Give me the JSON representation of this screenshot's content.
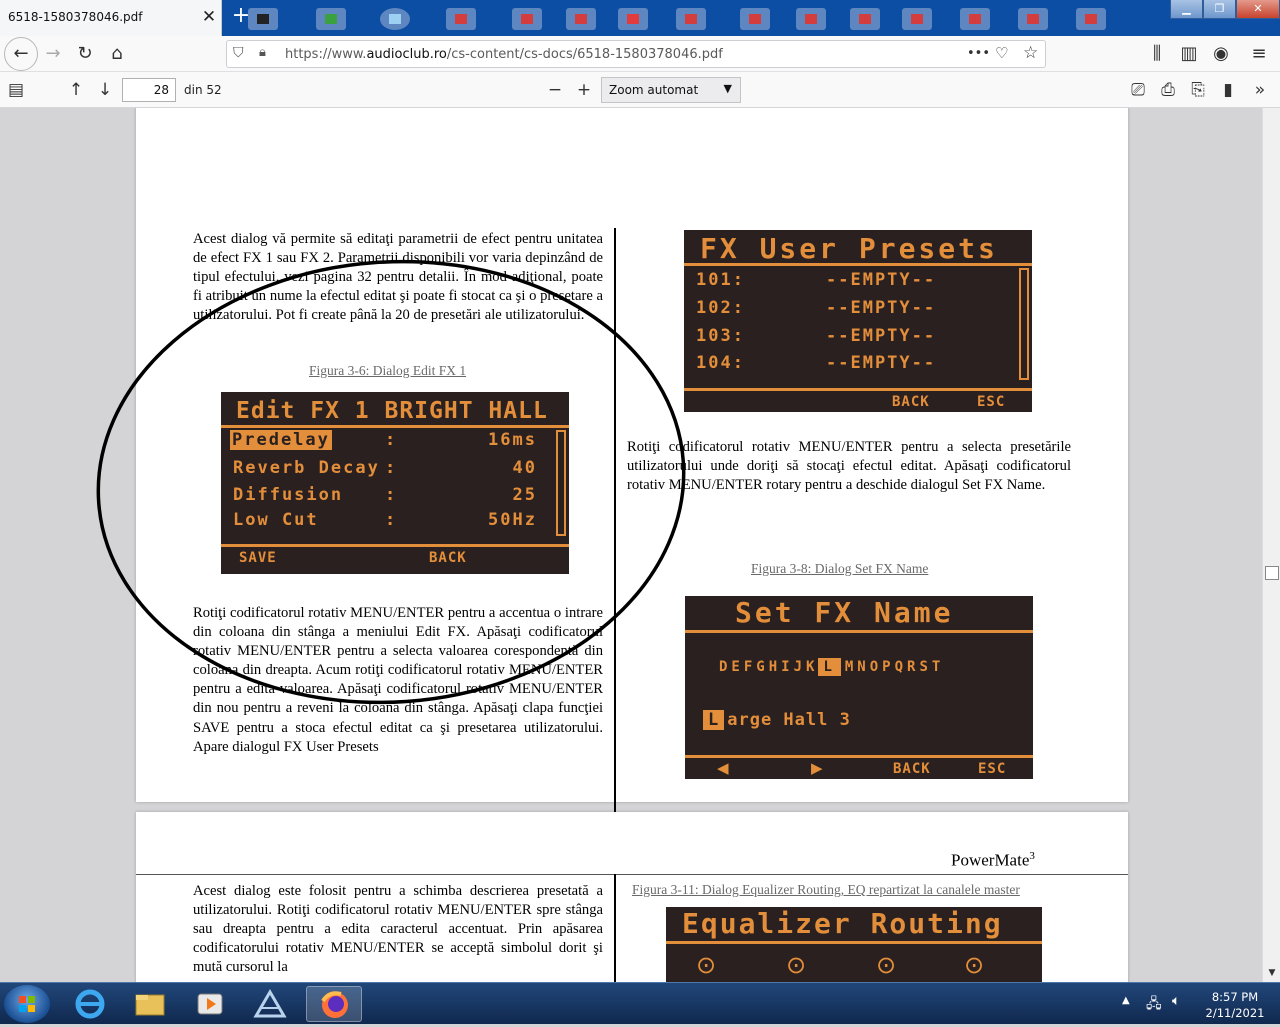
{
  "browser": {
    "tab_title": "6518-1580378046.pdf",
    "tab_close": "✕",
    "new_tab": "+",
    "url_prefix": "https://www.",
    "url_domain": "audioclub.ro",
    "url_path": "/cs-content/cs-docs/6518-1580378046.pdf",
    "url_more": "•••"
  },
  "pdf_toolbar": {
    "page_number": "28",
    "page_total": "din 52",
    "zoom_label": "Zoom automat"
  },
  "page1": {
    "left_paragraph_1": "Acest dialog vă permite să editaţi parametrii de efect pentru unitatea de efect FX 1 sau FX 2. Parametrii disponibili vor varia depinzând de tipul efectului, vezi pagina 32 pentru detalii. În mod adiţional, poate fi atribuit un nume la efectul editat şi poate fi stocat ca şi o presetare a utilizatorului. Pot fi create până la 20 de presetări ale utilizatorului.",
    "caption_fig36": "Figura 3-6: Dialog Edit  FX 1",
    "edit_fx": {
      "title": "Edit FX 1 BRIGHT HALL",
      "rows": [
        {
          "name": "Predelay",
          "sep": ":",
          "value": "16ms"
        },
        {
          "name": "Reverb Decay",
          "sep": ":",
          "value": "40"
        },
        {
          "name": "Diffusion",
          "sep": ":",
          "value": "25"
        },
        {
          "name": "Low Cut",
          "sep": ":",
          "value": "50Hz"
        }
      ],
      "soft_left": "SAVE",
      "soft_right": "BACK"
    },
    "left_paragraph_2": "Rotiţi codificatorul rotativ MENU/ENTER pentru a accentua o intrare din coloana din stânga a meniului Edit FX. Apăsaţi codificatorul rotativ MENU/ENTER pentru a selecta valoarea corespondentă din coloana din dreapta. Acum rotiţi codificatorul rotativ MENU/ENTER pentru a edita valoarea. Apăsaţi codificatorul rotativ MENU/ENTER din nou pentru a reveni la coloana din stânga. Apăsaţi clapa funcţiei SAVE pentru a stoca efectul editat ca şi presetarea utilizatorului. Apare dialogul FX User Presets",
    "user_presets": {
      "title": "FX User Presets",
      "rows": [
        {
          "num": "101:",
          "value": "--EMPTY--"
        },
        {
          "num": "102:",
          "value": "--EMPTY--"
        },
        {
          "num": "103:",
          "value": "--EMPTY--"
        },
        {
          "num": "104:",
          "value": "--EMPTY--"
        }
      ],
      "soft_left": "BACK",
      "soft_right": "ESC"
    },
    "right_paragraph_1": "Rotiţi codificatorul rotativ MENU/ENTER pentru a selecta presetările utilizatorului unde doriţi să stocaţi efectul editat. Apăsaţi codificatorul rotativ MENU/ENTER rotary pentru a deschide dialogul Set FX Name.",
    "caption_fig38": "Figura 3-8: Dialog Set FX Name",
    "set_name": {
      "title": "Set FX Name",
      "chars_before": "DEFGHIJK",
      "char_selected": "L",
      "chars_after": "MNOPQRST",
      "name_cursor": "L",
      "name_rest": "arge Hall 3",
      "soft_left_arrow": "◀",
      "soft_right_arrow": "▶",
      "soft_back": "BACK",
      "soft_esc": "ESC"
    },
    "page_number": "28"
  },
  "page2": {
    "header_title": "PowerMate",
    "header_sup": "3",
    "left_paragraph": "Acest dialog este folosit pentru a schimba descrierea presetată a utilizatorului. Rotiţi codificatorul rotativ MENU/ENTER spre stânga sau dreapta pentru a edita caracterul accentuat.  Prin apăsarea codificatorului rotativ MENU/ENTER se acceptă simbolul dorit şi mută cursorul la",
    "caption_fig311": "Figura 3-11:  Dialog Equalizer Routing, EQ repartizat la canalele master",
    "eq_title": "Equalizer Routing"
  },
  "taskbar": {
    "time": "8:57 PM",
    "date": "2/11/2021"
  },
  "colors": {
    "lcd_background": "#2a2020",
    "lcd_amber": "#e38e3a",
    "tabstrip": "#0c4ea3"
  }
}
